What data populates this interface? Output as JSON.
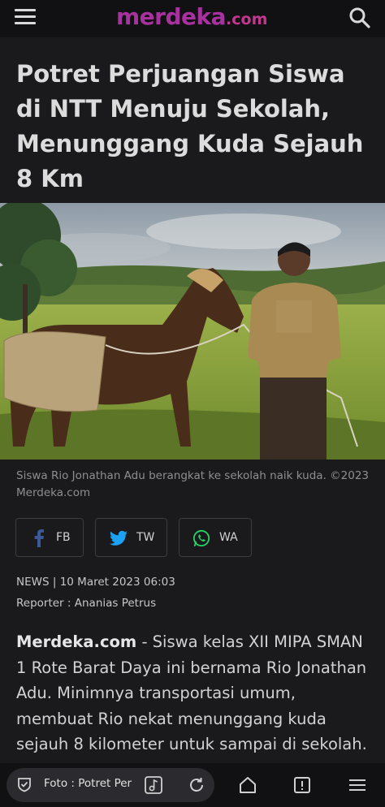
{
  "header": {
    "logo_brand": "merdeka",
    "logo_suffix": ".com",
    "menu_icon": "hamburger-icon",
    "search_icon": "search-icon",
    "logo_color": "#a8319f"
  },
  "article": {
    "title": "Potret Perjuangan Siswa di NTT Menuju Sekolah, Menunggang Kuda Sejauh 8 Km",
    "photo_caption": "Siswa Rio Jonathan Adu berangkat ke sekolah naik kuda. ©2023 Merdeka.com",
    "category": "NEWS",
    "separator": "|",
    "date": "10 Maret 2023 06:03",
    "reporter_label": "Reporter : ",
    "reporter_name": "Ananias Petrus",
    "lead_source": "Merdeka.com",
    "lead_text": " - Siswa kelas XII MIPA SMAN 1 Rote Barat Daya ini bernama Rio Jonathan Adu. Minimnya transportasi umum, membuat Rio nekat menunggang kuda sejauh 8 kilometer untuk sampai di sekolah."
  },
  "share": {
    "facebook_label": "FB",
    "twitter_label": "TW",
    "whatsapp_label": "WA",
    "facebook_color": "#3b5998",
    "twitter_color": "#1da1f2",
    "whatsapp_color": "#25d366"
  },
  "bottom_bar": {
    "tab_title": "Foto : Potret Per",
    "icons": [
      "shield-icon",
      "music-icon",
      "reload-icon",
      "home-icon",
      "tabs-icon",
      "menu-icon"
    ]
  }
}
